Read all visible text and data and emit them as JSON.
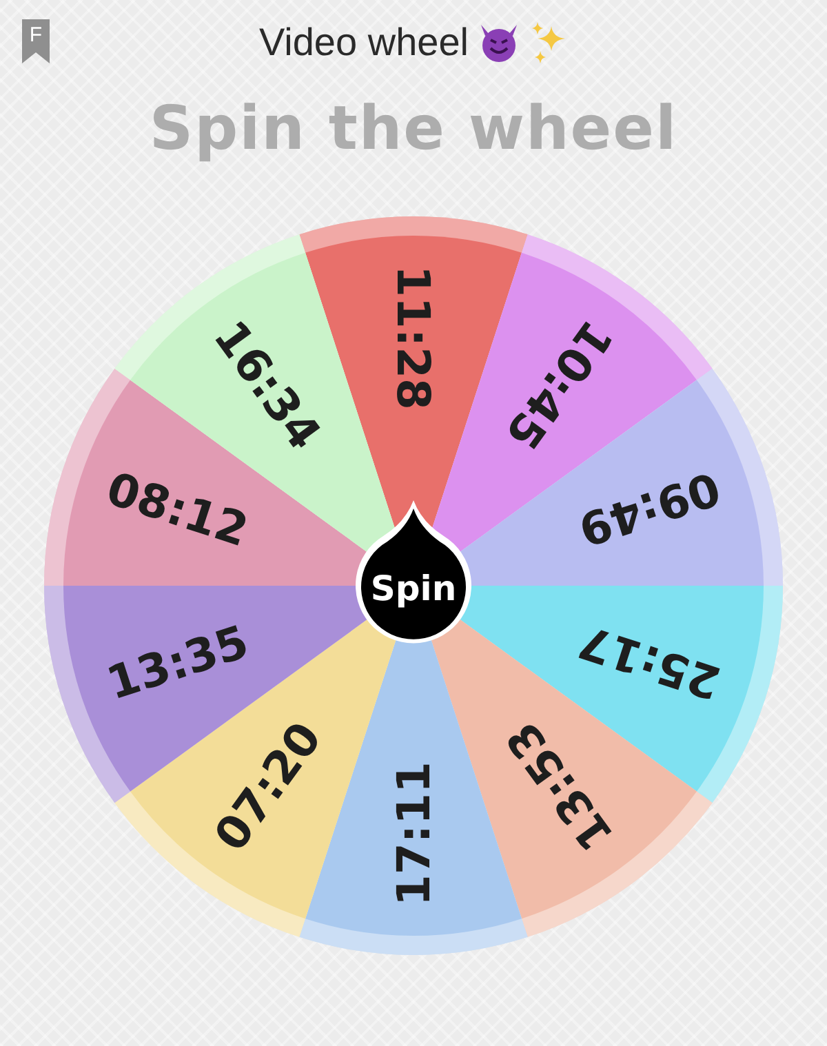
{
  "header": {
    "badge": "F",
    "title": "Video wheel"
  },
  "heading": "Spin the wheel",
  "wheel": {
    "segments": [
      {
        "label": "11:28",
        "color": "#e8706b"
      },
      {
        "label": "10:45",
        "color": "#dc91ef"
      },
      {
        "label": "09:49",
        "color": "#b8bdf1"
      },
      {
        "label": "25:17",
        "color": "#7fe1f1"
      },
      {
        "label": "13:53",
        "color": "#f1bca9"
      },
      {
        "label": "17:11",
        "color": "#a9c9ef"
      },
      {
        "label": "07:20",
        "color": "#f3dd98"
      },
      {
        "label": "13:35",
        "color": "#a98fd8"
      },
      {
        "label": "08:12",
        "color": "#e19bb3"
      },
      {
        "label": "16:34",
        "color": "#caf3ca"
      }
    ],
    "button": "Spin"
  }
}
